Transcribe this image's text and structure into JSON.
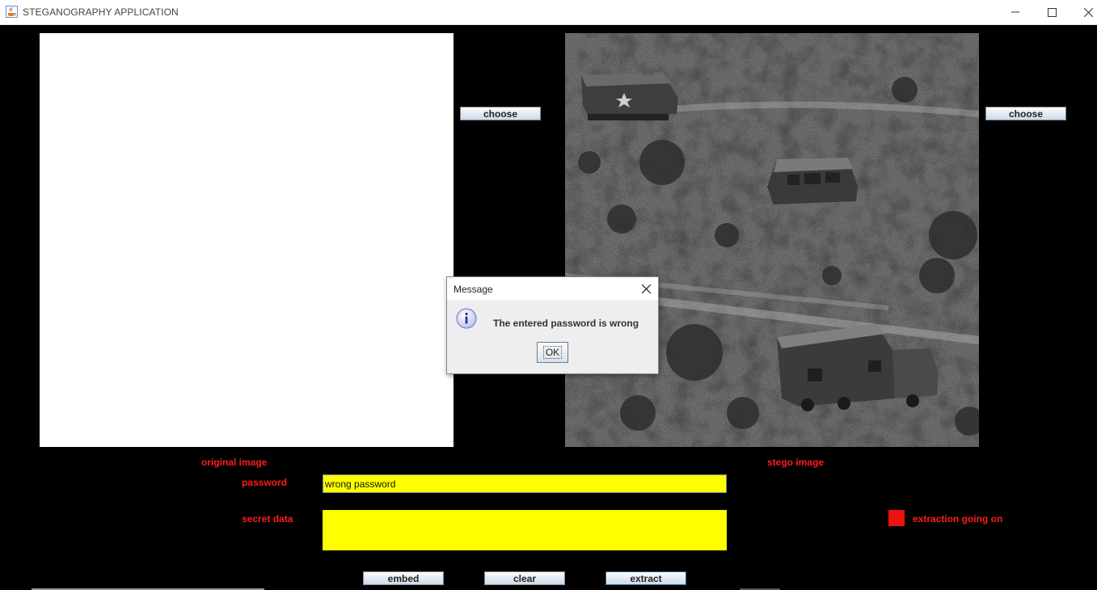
{
  "window": {
    "title": "STEGANOGRAPHY APPLICATION",
    "icon": "java-cup-icon",
    "controls": [
      "minimize-icon",
      "maximize-icon",
      "close-icon"
    ]
  },
  "panels": {
    "original": {
      "label": "original image",
      "choose_label": "choose"
    },
    "stego": {
      "label": "stego image",
      "choose_label": "choose"
    }
  },
  "form": {
    "password_label": "password",
    "password_value": "wrong password",
    "secret_label": "secret data",
    "secret_value": ""
  },
  "status": {
    "text": "extraction going on",
    "color": "#ee1111"
  },
  "buttons": {
    "embed": "embed",
    "clear": "clear",
    "extract": "extract"
  },
  "dialog": {
    "title": "Message",
    "message": "The entered password is wrong",
    "ok_label": "OK",
    "icon": "info-icon"
  },
  "colors": {
    "background": "#000000",
    "label": "#ff1a1a",
    "field": "#ffff00"
  }
}
